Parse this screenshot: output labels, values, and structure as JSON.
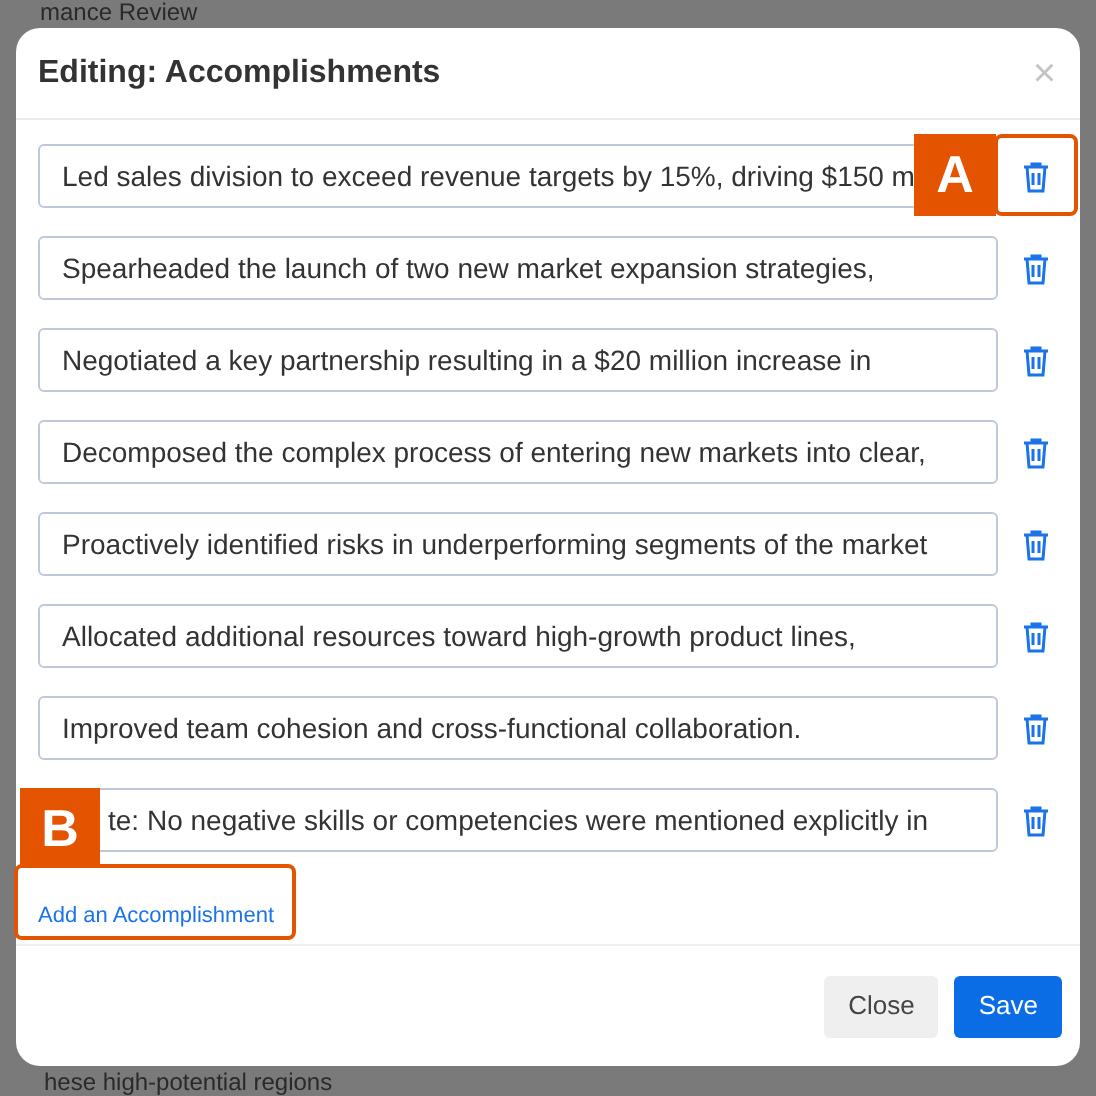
{
  "background": {
    "heading": "mance Review",
    "footer_text": "hese high-potential regions"
  },
  "dialog": {
    "title": "Editing: Accomplishments",
    "close": "×",
    "items": [
      {
        "text": "Led sales division to exceed revenue targets by 15%, driving $150 m"
      },
      {
        "text": "Spearheaded the launch of two new market expansion strategies,"
      },
      {
        "text": "Negotiated a key partnership resulting in a $20 million increase in"
      },
      {
        "text": "Decomposed the complex process of entering new markets into clear,"
      },
      {
        "text": "Proactively identified risks in underperforming segments of the market"
      },
      {
        "text": "Allocated additional resources toward high-growth product lines,"
      },
      {
        "text": "Improved team cohesion and cross-functional collaboration."
      },
      {
        "text": "te: No negative skills or competencies were mentioned explicitly in",
        "kind": "covered"
      }
    ],
    "add_link": "Add an Accomplishment",
    "buttons": [
      {
        "label": "Close",
        "kind": "secondary"
      },
      {
        "label": "Save",
        "kind": "primary"
      }
    ]
  },
  "annotations": [
    {
      "label": "A"
    },
    {
      "label": "B"
    }
  ]
}
